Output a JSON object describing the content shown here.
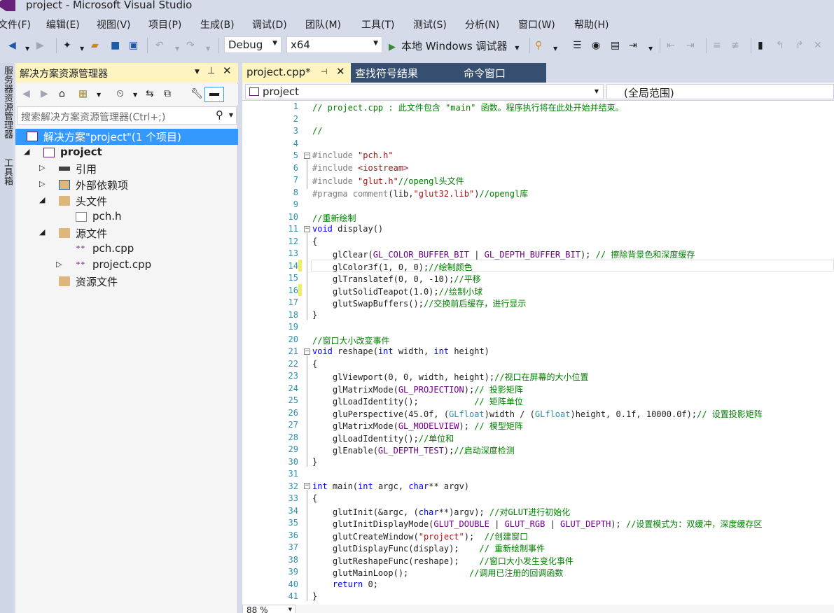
{
  "window": {
    "title": "project - Microsoft Visual Studio"
  },
  "menu": [
    "文件(F)",
    "编辑(E)",
    "视图(V)",
    "项目(P)",
    "生成(B)",
    "调试(D)",
    "团队(M)",
    "工具(T)",
    "测试(S)",
    "分析(N)",
    "窗口(W)",
    "帮助(H)"
  ],
  "toolbar": {
    "config": "Debug",
    "platform": "x64",
    "run_label": "本地 Windows 调试器"
  },
  "side_strip": {
    "top_tab": "服务器资源管理器",
    "bottom_tab": "工具箱"
  },
  "solution_explorer": {
    "title": "解决方案资源管理器",
    "search_placeholder": "搜索解决方案资源管理器(Ctrl+;)",
    "tree": [
      {
        "label": "解决方案\"project\"(1 个项目)",
        "icon": "solution-icon",
        "level": 0,
        "expander": "",
        "selected": true
      },
      {
        "label": "project",
        "icon": "project-icon",
        "level": 1,
        "expander": "◢",
        "bold": true
      },
      {
        "label": "引用",
        "icon": "references-icon",
        "level": 2,
        "expander": "▷"
      },
      {
        "label": "外部依赖项",
        "icon": "external-deps-icon",
        "level": 2,
        "expander": "▷"
      },
      {
        "label": "头文件",
        "icon": "folder-icon",
        "level": 2,
        "expander": "◢"
      },
      {
        "label": "pch.h",
        "icon": "header-file-icon",
        "level": 3,
        "expander": ""
      },
      {
        "label": "源文件",
        "icon": "folder-icon",
        "level": 2,
        "expander": "◢"
      },
      {
        "label": "pch.cpp",
        "icon": "cpp-file-icon",
        "level": 3,
        "expander": ""
      },
      {
        "label": "project.cpp",
        "icon": "cpp-file-icon",
        "level": 3,
        "expander": "▷"
      },
      {
        "label": "资源文件",
        "icon": "folder-icon",
        "level": 2,
        "expander": ""
      }
    ]
  },
  "tabs": [
    {
      "label": "project.cpp*",
      "active": true
    },
    {
      "label": "查找符号结果",
      "active": false
    },
    {
      "label": "命令窗口",
      "active": false
    }
  ],
  "nav": {
    "project": "project",
    "scope": "(全局范围)"
  },
  "status": {
    "zoom": "88 %"
  },
  "code": [
    [
      [
        "// project.cpp : 此文件包含 \"main\" 函数。程序执行将在此处开始并结束。",
        "c-comment"
      ]
    ],
    [
      [
        "",
        ""
      ]
    ],
    [
      [
        "//",
        "c-comment"
      ]
    ],
    [
      [
        "",
        ""
      ]
    ],
    [
      [
        "#include ",
        "c-pp"
      ],
      [
        "\"pch.h\"",
        "c-str"
      ]
    ],
    [
      [
        "#include ",
        "c-pp"
      ],
      [
        "<iostream>",
        "c-str"
      ]
    ],
    [
      [
        "#include ",
        "c-pp"
      ],
      [
        "\"glut.h\"",
        "c-str"
      ],
      [
        "//opengl头文件",
        "c-comment"
      ]
    ],
    [
      [
        "#pragma comment",
        "c-pp"
      ],
      [
        "(lib,",
        ""
      ],
      [
        "\"glut32.lib\"",
        "c-str"
      ],
      [
        ")",
        ""
      ],
      [
        "//opengl库",
        "c-comment"
      ]
    ],
    [
      [
        "",
        ""
      ]
    ],
    [
      [
        "//重新绘制",
        "c-comment"
      ]
    ],
    [
      [
        "void",
        "c-kw"
      ],
      [
        " display()",
        ""
      ]
    ],
    [
      [
        "{",
        ""
      ]
    ],
    [
      [
        "    glClear(",
        ""
      ],
      [
        "GL_COLOR_BUFFER_BIT",
        "c-mac"
      ],
      [
        " | ",
        ""
      ],
      [
        "GL_DEPTH_BUFFER_BIT",
        "c-mac"
      ],
      [
        "); ",
        ""
      ],
      [
        "// 擦除背景色和深度缓存",
        "c-comment"
      ]
    ],
    [
      [
        "    glColor3f(1, 0, 0);",
        ""
      ],
      [
        "//绘制颜色",
        "c-comment"
      ]
    ],
    [
      [
        "    glTranslatef(0, 0, -10);",
        ""
      ],
      [
        "//平移",
        "c-comment"
      ]
    ],
    [
      [
        "    glutSolidTeapot(1.0);",
        ""
      ],
      [
        "//绘制小球",
        "c-comment"
      ]
    ],
    [
      [
        "    glutSwapBuffers();",
        ""
      ],
      [
        "//交换前后缓存，进行显示",
        "c-comment"
      ]
    ],
    [
      [
        "}",
        ""
      ]
    ],
    [
      [
        "",
        ""
      ]
    ],
    [
      [
        "//窗口大小改变事件",
        "c-comment"
      ]
    ],
    [
      [
        "void",
        "c-kw"
      ],
      [
        " reshape(",
        ""
      ],
      [
        "int",
        "c-kw"
      ],
      [
        " width, ",
        ""
      ],
      [
        "int",
        "c-kw"
      ],
      [
        " height)",
        ""
      ]
    ],
    [
      [
        "{",
        ""
      ]
    ],
    [
      [
        "    glViewport(0, 0, width, height);",
        ""
      ],
      [
        "//视口在屏幕的大小位置",
        "c-comment"
      ]
    ],
    [
      [
        "    glMatrixMode(",
        ""
      ],
      [
        "GL_PROJECTION",
        "c-mac"
      ],
      [
        ");",
        ""
      ],
      [
        "// 投影矩阵",
        "c-comment"
      ]
    ],
    [
      [
        "    glLoadIdentity();           ",
        ""
      ],
      [
        "// 矩阵单位",
        "c-comment"
      ]
    ],
    [
      [
        "    gluPerspective(45.0f, (",
        ""
      ],
      [
        "GLfloat",
        "c-type"
      ],
      [
        ")width / (",
        ""
      ],
      [
        "GLfloat",
        "c-type"
      ],
      [
        ")height, 0.1f, 10000.0f);",
        ""
      ],
      [
        "// 设置投影矩阵",
        "c-comment"
      ]
    ],
    [
      [
        "    glMatrixMode(",
        ""
      ],
      [
        "GL_MODELVIEW",
        "c-mac"
      ],
      [
        "); ",
        ""
      ],
      [
        "// 模型矩阵",
        "c-comment"
      ]
    ],
    [
      [
        "    glLoadIdentity();",
        ""
      ],
      [
        "//单位和",
        "c-comment"
      ]
    ],
    [
      [
        "    glEnable(",
        ""
      ],
      [
        "GL_DEPTH_TEST",
        "c-mac"
      ],
      [
        ");",
        ""
      ],
      [
        "//启动深度检测",
        "c-comment"
      ]
    ],
    [
      [
        "}",
        ""
      ]
    ],
    [
      [
        "",
        ""
      ]
    ],
    [
      [
        "int",
        "c-kw"
      ],
      [
        " main(",
        ""
      ],
      [
        "int",
        "c-kw"
      ],
      [
        " argc, ",
        ""
      ],
      [
        "char",
        "c-kw"
      ],
      [
        "** argv)",
        ""
      ]
    ],
    [
      [
        "{",
        ""
      ]
    ],
    [
      [
        "    glutInit(&argc, (",
        ""
      ],
      [
        "char",
        "c-kw"
      ],
      [
        "**)argv); ",
        ""
      ],
      [
        "//对GLUT进行初始化",
        "c-comment"
      ]
    ],
    [
      [
        "    glutInitDisplayMode(",
        ""
      ],
      [
        "GLUT_DOUBLE",
        "c-mac"
      ],
      [
        " | ",
        ""
      ],
      [
        "GLUT_RGB",
        "c-mac"
      ],
      [
        " | ",
        ""
      ],
      [
        "GLUT_DEPTH",
        "c-mac"
      ],
      [
        "); ",
        ""
      ],
      [
        "//设置模式为：双缓冲，深度缓存区",
        "c-comment"
      ]
    ],
    [
      [
        "    glutCreateWindow(",
        ""
      ],
      [
        "\"project\"",
        "c-str"
      ],
      [
        ");  ",
        ""
      ],
      [
        "//创建窗口",
        "c-comment"
      ]
    ],
    [
      [
        "    glutDisplayFunc(display);    ",
        ""
      ],
      [
        "// 重新绘制事件",
        "c-comment"
      ]
    ],
    [
      [
        "    glutReshapeFunc(reshape);    ",
        ""
      ],
      [
        "//窗口大小发生变化事件",
        "c-comment"
      ]
    ],
    [
      [
        "    glutMainLoop();            ",
        ""
      ],
      [
        "//调用已注册的回调函数",
        "c-comment"
      ]
    ],
    [
      [
        "    ",
        ""
      ],
      [
        "return",
        "c-kw"
      ],
      [
        " 0;",
        ""
      ]
    ],
    [
      [
        "}",
        ""
      ]
    ]
  ]
}
